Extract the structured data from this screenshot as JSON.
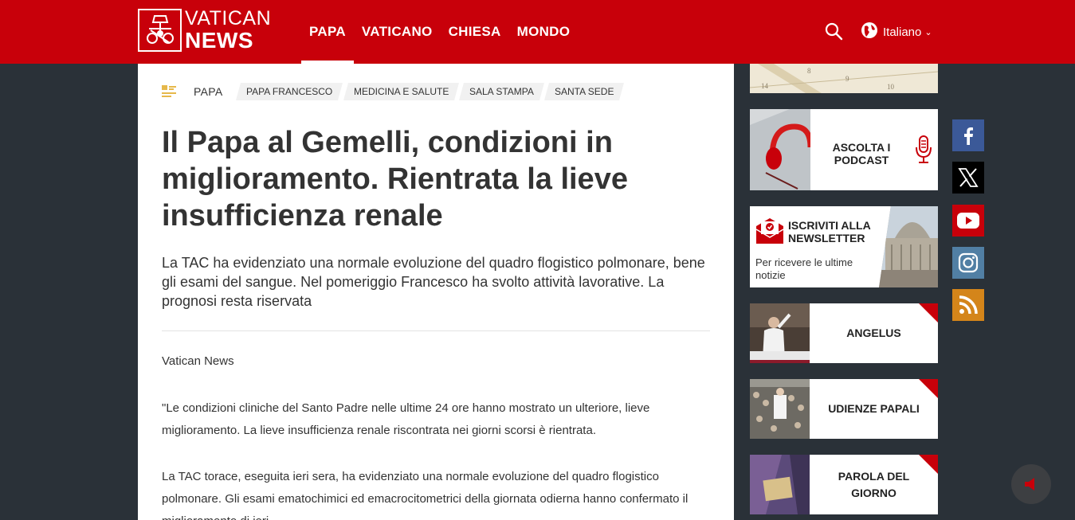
{
  "brand": {
    "line1": "VATICAN",
    "line2": "NEWS"
  },
  "nav": {
    "items": [
      "PAPA",
      "VATICANO",
      "CHIESA",
      "MONDO"
    ],
    "active": "PAPA"
  },
  "header": {
    "language": "Italiano"
  },
  "tags": {
    "main": "PAPA",
    "items": [
      "PAPA FRANCESCO",
      "MEDICINA E SALUTE",
      "SALA STAMPA",
      "SANTA SEDE"
    ]
  },
  "article": {
    "title": "Il Papa al Gemelli, condizioni in miglioramento. Rientrata la lieve insufficienza renale",
    "subtitle": "La TAC ha evidenziato una normale evoluzione del quadro flogistico polmonare, bene gli esami del sangue. Nel pomeriggio Francesco ha svolto attività lavorative. La prognosi resta riservata",
    "byline": "Vatican News",
    "paragraphs": [
      "\"Le condizioni cliniche del Santo Padre nelle ultime 24 ore hanno mostrato un ulteriore, lieve miglioramento. La lieve insufficienza renale riscontrata nei giorni scorsi è rientrata.",
      "La TAC torace, eseguita ieri sera, ha evidenziato una normale evoluzione del quadro flogistico polmonare. Gli esami ematochimici ed emacrocitometrici della giornata odierna hanno confermato il miglioramento di ieri."
    ]
  },
  "sidebar": {
    "calendar_numbers": [
      "14",
      "8",
      "9",
      "10"
    ],
    "podcast": {
      "label": "ASCOLTA I PODCAST"
    },
    "newsletter": {
      "title": "ISCRIVITI ALLA NEWSLETTER",
      "subtitle": "Per ricevere le ultime notizie"
    },
    "features": [
      {
        "label": "ANGELUS"
      },
      {
        "label": "UDIENZE PAPALI"
      },
      {
        "label": "PAROLA DEL GIORNO"
      }
    ]
  },
  "social": [
    "facebook-icon",
    "x-icon",
    "youtube-icon",
    "instagram-icon",
    "rss-icon"
  ],
  "colors": {
    "brand_red": "#c8000a",
    "background": "#2a3138",
    "tag_icon": "#e6b84a"
  }
}
